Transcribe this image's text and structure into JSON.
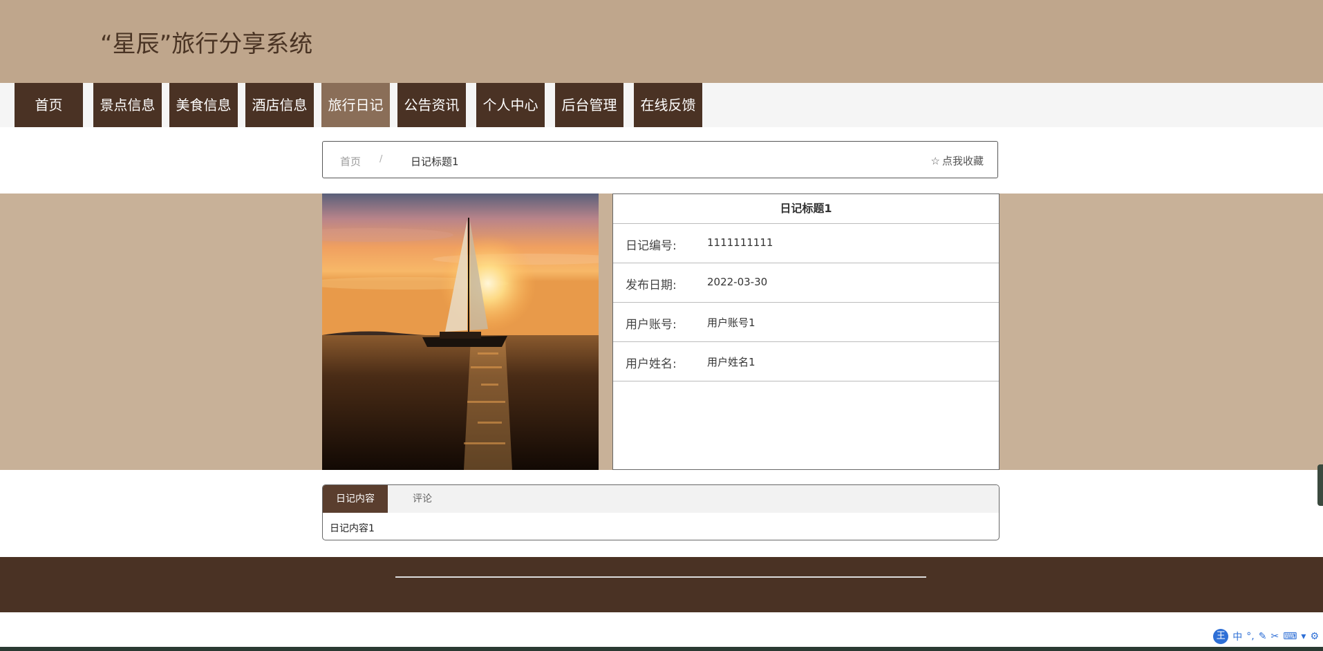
{
  "site": {
    "title": "“星辰”旅行分享系统"
  },
  "nav": {
    "items": [
      "首页",
      "景点信息",
      "美食信息",
      "酒店信息",
      "旅行日记",
      "公告资讯",
      "个人中心",
      "后台管理",
      "在线反馈"
    ],
    "active_index": 4
  },
  "breadcrumb": {
    "home": "首页",
    "separator": "/",
    "current": "日记标题1"
  },
  "favorite": {
    "label": "点我收藏",
    "icon": "star-outline-icon"
  },
  "detail": {
    "title": "日记标题1",
    "fields": [
      {
        "label": "日记编号:",
        "value": "1111111111"
      },
      {
        "label": "发布日期:",
        "value": "2022-03-30"
      },
      {
        "label": "用户账号:",
        "value": "用户账号1"
      },
      {
        "label": "用户姓名:",
        "value": "用户姓名1"
      }
    ]
  },
  "tabs": {
    "items": [
      "日记内容",
      "评论"
    ],
    "content": "日记内容1"
  },
  "ime": {
    "logo": "王",
    "mode": "中"
  },
  "colors": {
    "header_bg": "#bfa68c",
    "nav_bg": "#4a3224",
    "nav_active_bg": "#8a6e58",
    "band_bg": "#c8b198",
    "footer_bg": "#4a3224"
  }
}
